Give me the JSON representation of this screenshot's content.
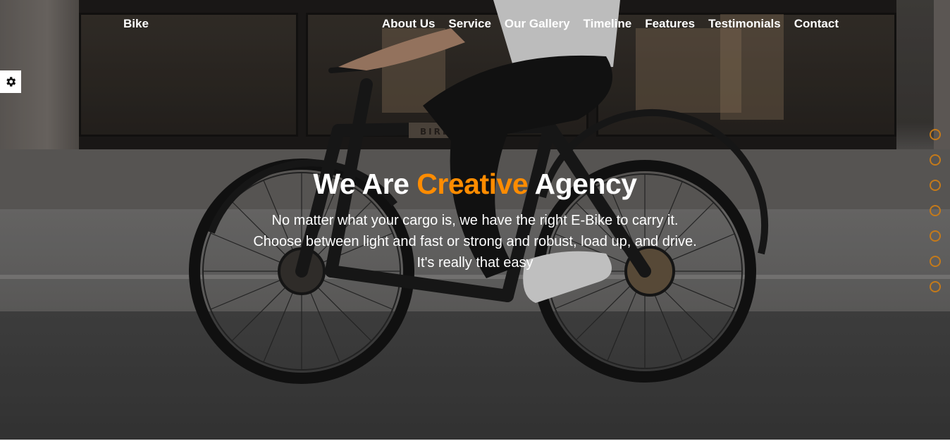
{
  "brand": "Bike",
  "nav": {
    "items": [
      "About Us",
      "Service",
      "Our Gallery",
      "Timeline",
      "Features",
      "Testimonials",
      "Contact"
    ]
  },
  "settings": {
    "icon": "gear-icon"
  },
  "hero": {
    "headline_part1": "We Are",
    "headline_accent": "Creative",
    "headline_part2": "Agency",
    "sub_lines": [
      "No matter what your cargo is, we have the right E-Bike to carry it.",
      "Choose between light and fast or strong and robust, load up, and drive.",
      "It's really that easy"
    ],
    "bike_label": "BIRD"
  },
  "slider": {
    "dot_count": 7
  },
  "colors": {
    "accent": "#ff8c00",
    "dot_border": "#c47a1a",
    "text": "#ffffff"
  }
}
